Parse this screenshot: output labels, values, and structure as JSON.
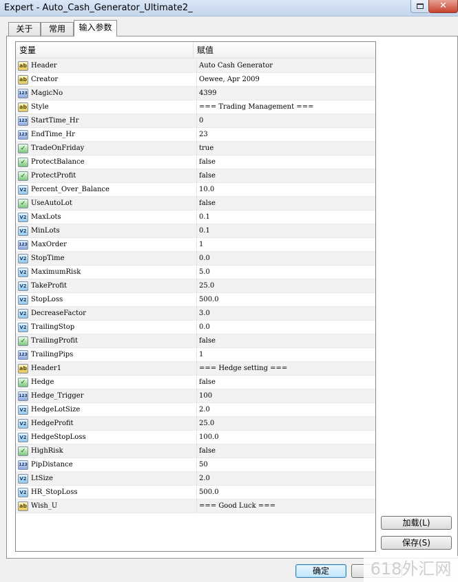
{
  "window": {
    "title": "Expert - Auto_Cash_Generator_Ultimate2_",
    "close_label": "✕"
  },
  "tabs": [
    {
      "label": "关于"
    },
    {
      "label": "常用"
    },
    {
      "label": "输入参数",
      "active": true
    }
  ],
  "table": {
    "headers": {
      "variable": "变量",
      "value": "赋值"
    },
    "rows": [
      {
        "type": "string",
        "icon": "ab",
        "name": "Header",
        "value": "Auto Cash Generator"
      },
      {
        "type": "string",
        "icon": "ab",
        "name": "Creator",
        "value": "Oewee, Apr 2009"
      },
      {
        "type": "int",
        "icon": "123",
        "name": "MagicNo",
        "value": "4399"
      },
      {
        "type": "string",
        "icon": "ab",
        "name": "Style",
        "value": "=== Trading Management ==="
      },
      {
        "type": "int",
        "icon": "123",
        "name": "StartTime_Hr",
        "value": "0"
      },
      {
        "type": "int",
        "icon": "123",
        "name": "EndTime_Hr",
        "value": "23"
      },
      {
        "type": "bool",
        "icon": "✓",
        "name": "TradeOnFriday",
        "value": "true"
      },
      {
        "type": "bool",
        "icon": "✓",
        "name": "ProtectBalance",
        "value": "false"
      },
      {
        "type": "bool",
        "icon": "✓",
        "name": "ProtectProfit",
        "value": "false"
      },
      {
        "type": "double",
        "icon": "V2",
        "name": "Percent_Over_Balance",
        "value": "10.0"
      },
      {
        "type": "bool",
        "icon": "✓",
        "name": "UseAutoLot",
        "value": "false"
      },
      {
        "type": "double",
        "icon": "V2",
        "name": "MaxLots",
        "value": "0.1"
      },
      {
        "type": "double",
        "icon": "V2",
        "name": "MinLots",
        "value": "0.1"
      },
      {
        "type": "int",
        "icon": "123",
        "name": "MaxOrder",
        "value": "1"
      },
      {
        "type": "double",
        "icon": "V2",
        "name": "StopTime",
        "value": "0.0"
      },
      {
        "type": "double",
        "icon": "V2",
        "name": "MaximumRisk",
        "value": "5.0"
      },
      {
        "type": "double",
        "icon": "V2",
        "name": "TakeProfit",
        "value": "25.0"
      },
      {
        "type": "double",
        "icon": "V2",
        "name": "StopLoss",
        "value": "500.0"
      },
      {
        "type": "double",
        "icon": "V2",
        "name": "DecreaseFactor",
        "value": "3.0"
      },
      {
        "type": "double",
        "icon": "V2",
        "name": "TrailingStop",
        "value": "0.0"
      },
      {
        "type": "bool",
        "icon": "✓",
        "name": "TrailingProfit",
        "value": "false"
      },
      {
        "type": "int",
        "icon": "123",
        "name": "TrailingPips",
        "value": "1"
      },
      {
        "type": "string",
        "icon": "ab",
        "name": "Header1",
        "value": "=== Hedge setting ==="
      },
      {
        "type": "bool",
        "icon": "✓",
        "name": "Hedge",
        "value": "false"
      },
      {
        "type": "int",
        "icon": "123",
        "name": "Hedge_Trigger",
        "value": "100"
      },
      {
        "type": "double",
        "icon": "V2",
        "name": "HedgeLotSize",
        "value": "2.0"
      },
      {
        "type": "double",
        "icon": "V2",
        "name": "HedgeProfit",
        "value": "25.0"
      },
      {
        "type": "double",
        "icon": "V2",
        "name": "HedgeStopLoss",
        "value": "100.0"
      },
      {
        "type": "bool",
        "icon": "✓",
        "name": "HighRisk",
        "value": "false"
      },
      {
        "type": "int",
        "icon": "123",
        "name": "PipDistance",
        "value": "50"
      },
      {
        "type": "double",
        "icon": "V2",
        "name": "LtSize",
        "value": "2.0"
      },
      {
        "type": "double",
        "icon": "V2",
        "name": "HR_StopLoss",
        "value": "500.0"
      },
      {
        "type": "string",
        "icon": "ab",
        "name": "Wish_U",
        "value": "=== Good Luck ==="
      }
    ]
  },
  "buttons": {
    "load": "加载(L)",
    "save": "保存(S)",
    "ok": "确定"
  },
  "watermark": "618外汇网",
  "colors": {
    "titlebar": "#c4d6ec",
    "close_button": "#c7432f",
    "ok_button_border": "#3c7fb1"
  }
}
